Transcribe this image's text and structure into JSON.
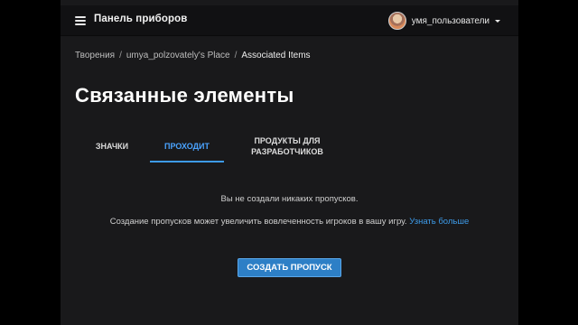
{
  "header": {
    "title": "Панель приборов",
    "username": "умя_пользователи"
  },
  "breadcrumb": {
    "items": [
      "Творения",
      "umya_polzovately's Place",
      "Associated Items"
    ],
    "separator": "/"
  },
  "page": {
    "title": "Связанные элементы"
  },
  "tabs": [
    {
      "label": "ЗНАЧКИ",
      "active": false
    },
    {
      "label": "ПРОХОДИТ",
      "active": true
    },
    {
      "label": "ПРОДУКТЫ ДЛЯ РАЗРАБОТЧИКОВ",
      "active": false
    }
  ],
  "content": {
    "empty_message": "Вы не создали никаких пропусков.",
    "hint_text": "Создание пропусков может увеличить вовлеченность игроков в вашу игру.",
    "learn_more": "Узнать больше",
    "create_button": "СОЗДАТЬ ПРОПУСК"
  },
  "colors": {
    "accent": "#3d9be9",
    "background": "#19191b",
    "topbar": "#111113",
    "button": "#2d7fc6"
  }
}
